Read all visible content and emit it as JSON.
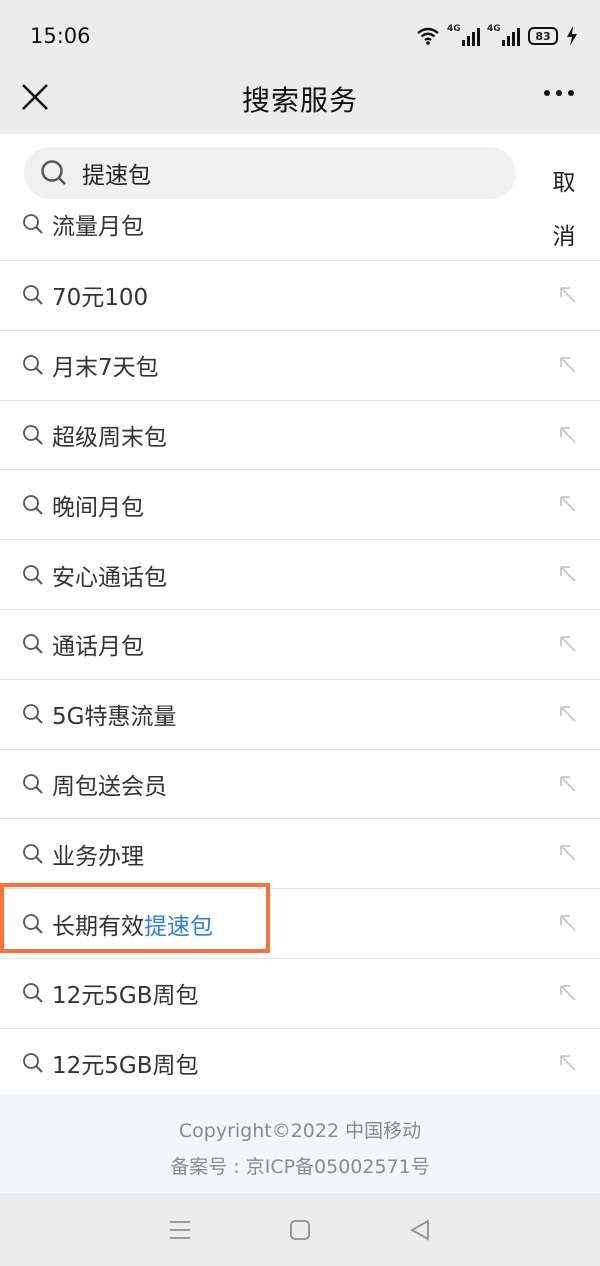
{
  "status_bar": {
    "time": "15:06",
    "network_1": "4G",
    "network_2": "4G",
    "battery": "83"
  },
  "header": {
    "title": "搜索服务",
    "close_icon": "close-icon",
    "more_icon": "more-icon"
  },
  "search": {
    "value": "提速包",
    "cancel_label": "取消"
  },
  "first_suggestion": "流量月包",
  "suggestions": [
    {
      "prefix": "70元100",
      "match": ""
    },
    {
      "prefix": "月末7天包",
      "match": ""
    },
    {
      "prefix": "超级周末包",
      "match": ""
    },
    {
      "prefix": "晚间月包",
      "match": ""
    },
    {
      "prefix": "安心通话包",
      "match": ""
    },
    {
      "prefix": "通话月包",
      "match": ""
    },
    {
      "prefix": "5G特惠流量",
      "match": ""
    },
    {
      "prefix": "周包送会员",
      "match": ""
    },
    {
      "prefix": "业务办理",
      "match": ""
    },
    {
      "prefix": "长期有效",
      "match": "提速包"
    },
    {
      "prefix": "12元5GB周包",
      "match": ""
    },
    {
      "prefix": "12元5GB周包",
      "match": ""
    }
  ],
  "footer": {
    "copyright": "Copyright©2022 中国移动",
    "icp": "备案号 : 京ICP备05002571号"
  },
  "colors": {
    "accent": "#2f7ed8",
    "highlight_frame": "#f2743f"
  }
}
